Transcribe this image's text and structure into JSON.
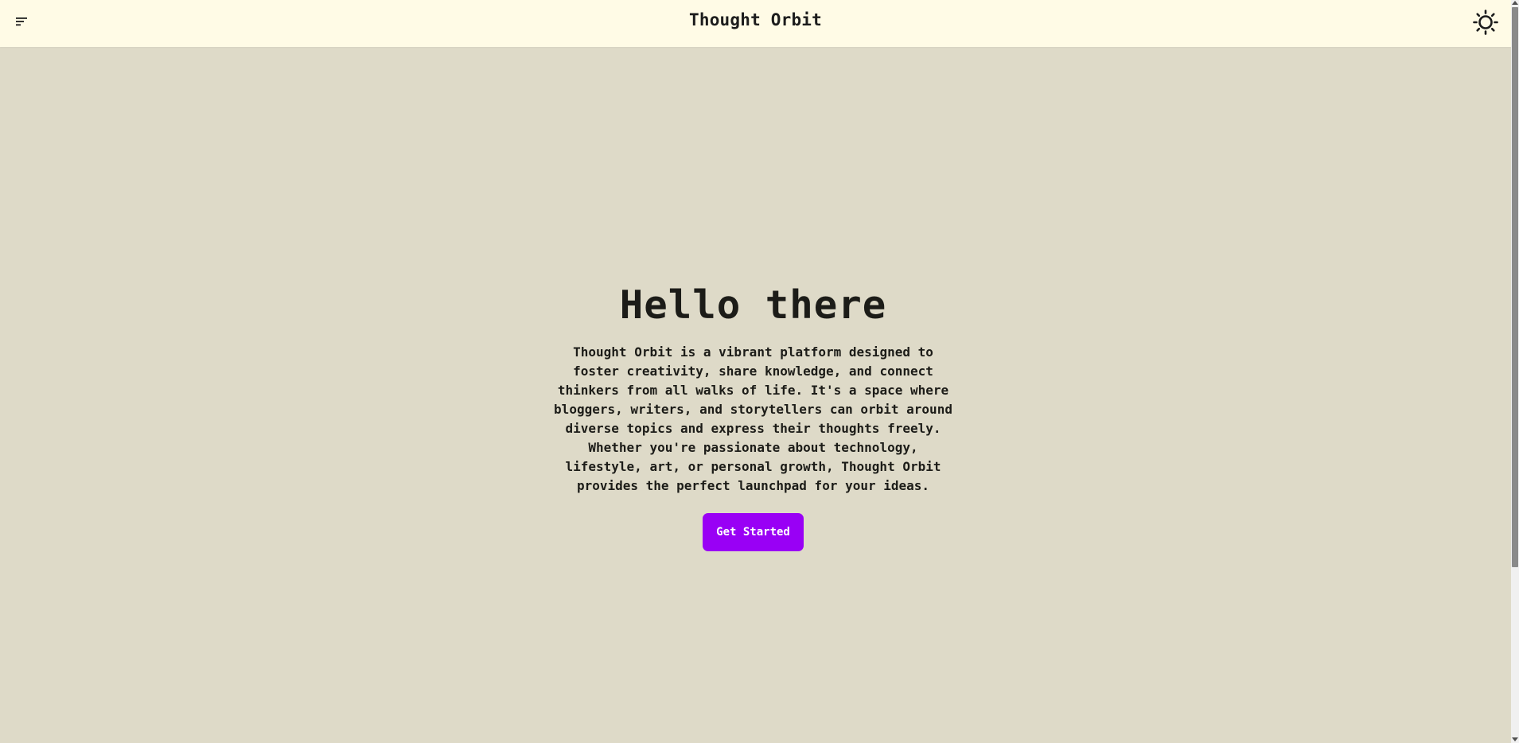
{
  "navbar": {
    "title": "Thought Orbit",
    "menu_icon": "hamburger-menu-icon",
    "theme_icon": "sun-icon"
  },
  "hero": {
    "heading": "Hello there",
    "description": "Thought Orbit is a vibrant platform designed to foster creativity, share knowledge, and connect thinkers from all walks of life. It's a space where bloggers, writers, and storytellers can orbit around diverse topics and express their thoughts freely. Whether you're passionate about technology, lifestyle, art, or personal growth, Thought Orbit provides the perfect launchpad for your ideas.",
    "cta_label": "Get Started"
  },
  "colors": {
    "navbar_bg": "#fffbe6",
    "page_bg": "#dedac8",
    "accent": "#9900f5",
    "text": "#1c1c18"
  }
}
